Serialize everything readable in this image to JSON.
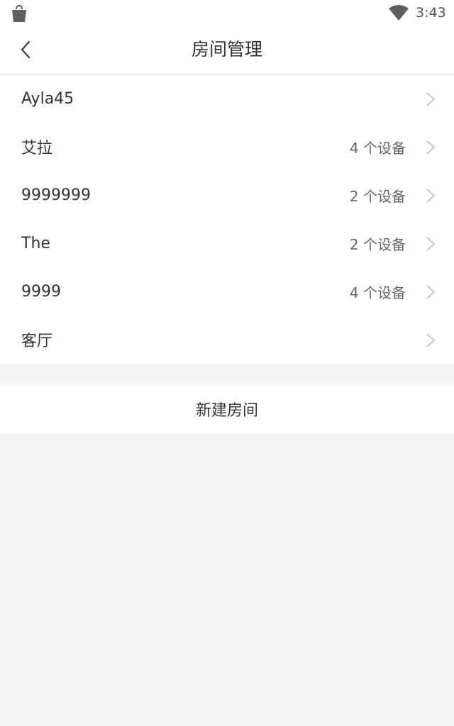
{
  "status_bar": {
    "time": "3:43",
    "icons": [
      "shopping-bag-icon",
      "wifi-icon"
    ]
  },
  "header": {
    "title": "房间管理",
    "back_icon": "chevron-left-icon"
  },
  "rooms": [
    {
      "name": "Ayla45",
      "count": ""
    },
    {
      "name": "艾拉",
      "count": "4 个设备"
    },
    {
      "name": "9999999",
      "count": "2 个设备"
    },
    {
      "name": "The",
      "count": "2 个设备"
    },
    {
      "name": "9999",
      "count": "4 个设备"
    },
    {
      "name": "客厅",
      "count": ""
    }
  ],
  "new_room_label": "新建房间",
  "colors": {
    "background": "#f4f4f4",
    "surface": "#ffffff",
    "text": "#333333",
    "secondary_text": "#666666",
    "chevron": "#c8c8c8"
  }
}
